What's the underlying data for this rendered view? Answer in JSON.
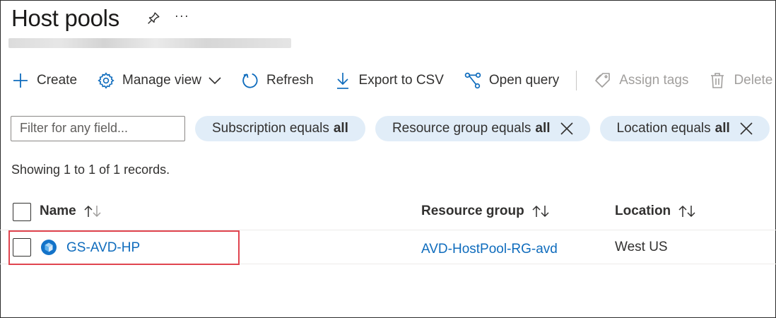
{
  "page": {
    "title": "Host pools",
    "pin_icon": "pin-icon",
    "more_label": "···"
  },
  "toolbar": {
    "create_label": "Create",
    "manage_view_label": "Manage view",
    "refresh_label": "Refresh",
    "export_label": "Export to CSV",
    "open_query_label": "Open query",
    "assign_tags_label": "Assign tags",
    "delete_label": "Delete"
  },
  "filters": {
    "placeholder": "Filter for any field...",
    "pills": [
      {
        "prefix": "Subscription equals",
        "value": "all"
      },
      {
        "prefix": "Resource group equals",
        "value": "all"
      },
      {
        "prefix": "Location equals",
        "value": "all"
      }
    ]
  },
  "status": {
    "records_text": "Showing 1 to 1 of 1 records."
  },
  "table": {
    "columns": [
      {
        "label": "Name"
      },
      {
        "label": "Resource group"
      },
      {
        "label": "Location"
      }
    ],
    "rows": [
      {
        "name": "GS-AVD-HP",
        "resource_group": "AVD-HostPool-RG-avd",
        "location": "West US"
      }
    ]
  },
  "colors": {
    "link": "#0f6cbd",
    "pill_bg": "#e1edf8",
    "highlight": "#e0454f",
    "disabled": "#a19f9d"
  }
}
